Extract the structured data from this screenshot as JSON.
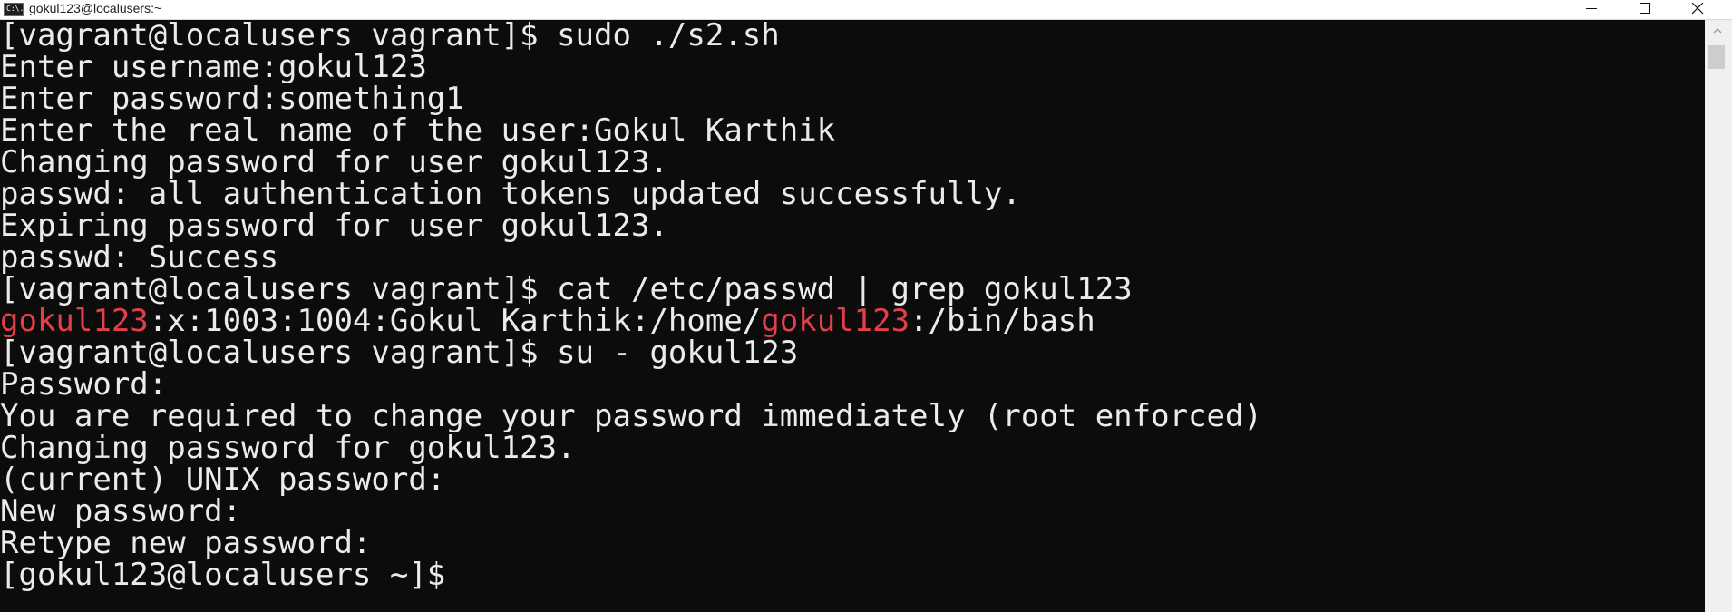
{
  "window": {
    "title": "gokul123@localusers:~",
    "icon": "console-icon",
    "icon_label": "C:\\."
  },
  "terminal": {
    "background": "#0c0c0c",
    "foreground": "#ebebeb",
    "highlight_color": "#e23f49",
    "lines": [
      "[vagrant@localusers vagrant]$ sudo ./s2.sh",
      "Enter username:gokul123",
      "Enter password:something1",
      "Enter the real name of the user:Gokul Karthik",
      "Changing password for user gokul123.",
      "passwd: all authentication tokens updated successfully.",
      "Expiring password for user gokul123.",
      "passwd: Success",
      "[vagrant@localusers vagrant]$ cat /etc/passwd | grep gokul123",
      "",
      "[vagrant@localusers vagrant]$ su - gokul123",
      "Password:",
      "You are required to change your password immediately (root enforced)",
      "Changing password for gokul123.",
      "(current) UNIX password:",
      "New password:",
      "Retype new password:",
      "[gokul123@localusers ~]$"
    ],
    "grep_result": {
      "match_1": "gokul123",
      "middle": ":x:1003:1004:Gokul Karthik:/home/",
      "match_2": "gokul123",
      "tail": ":/bin/bash"
    }
  }
}
